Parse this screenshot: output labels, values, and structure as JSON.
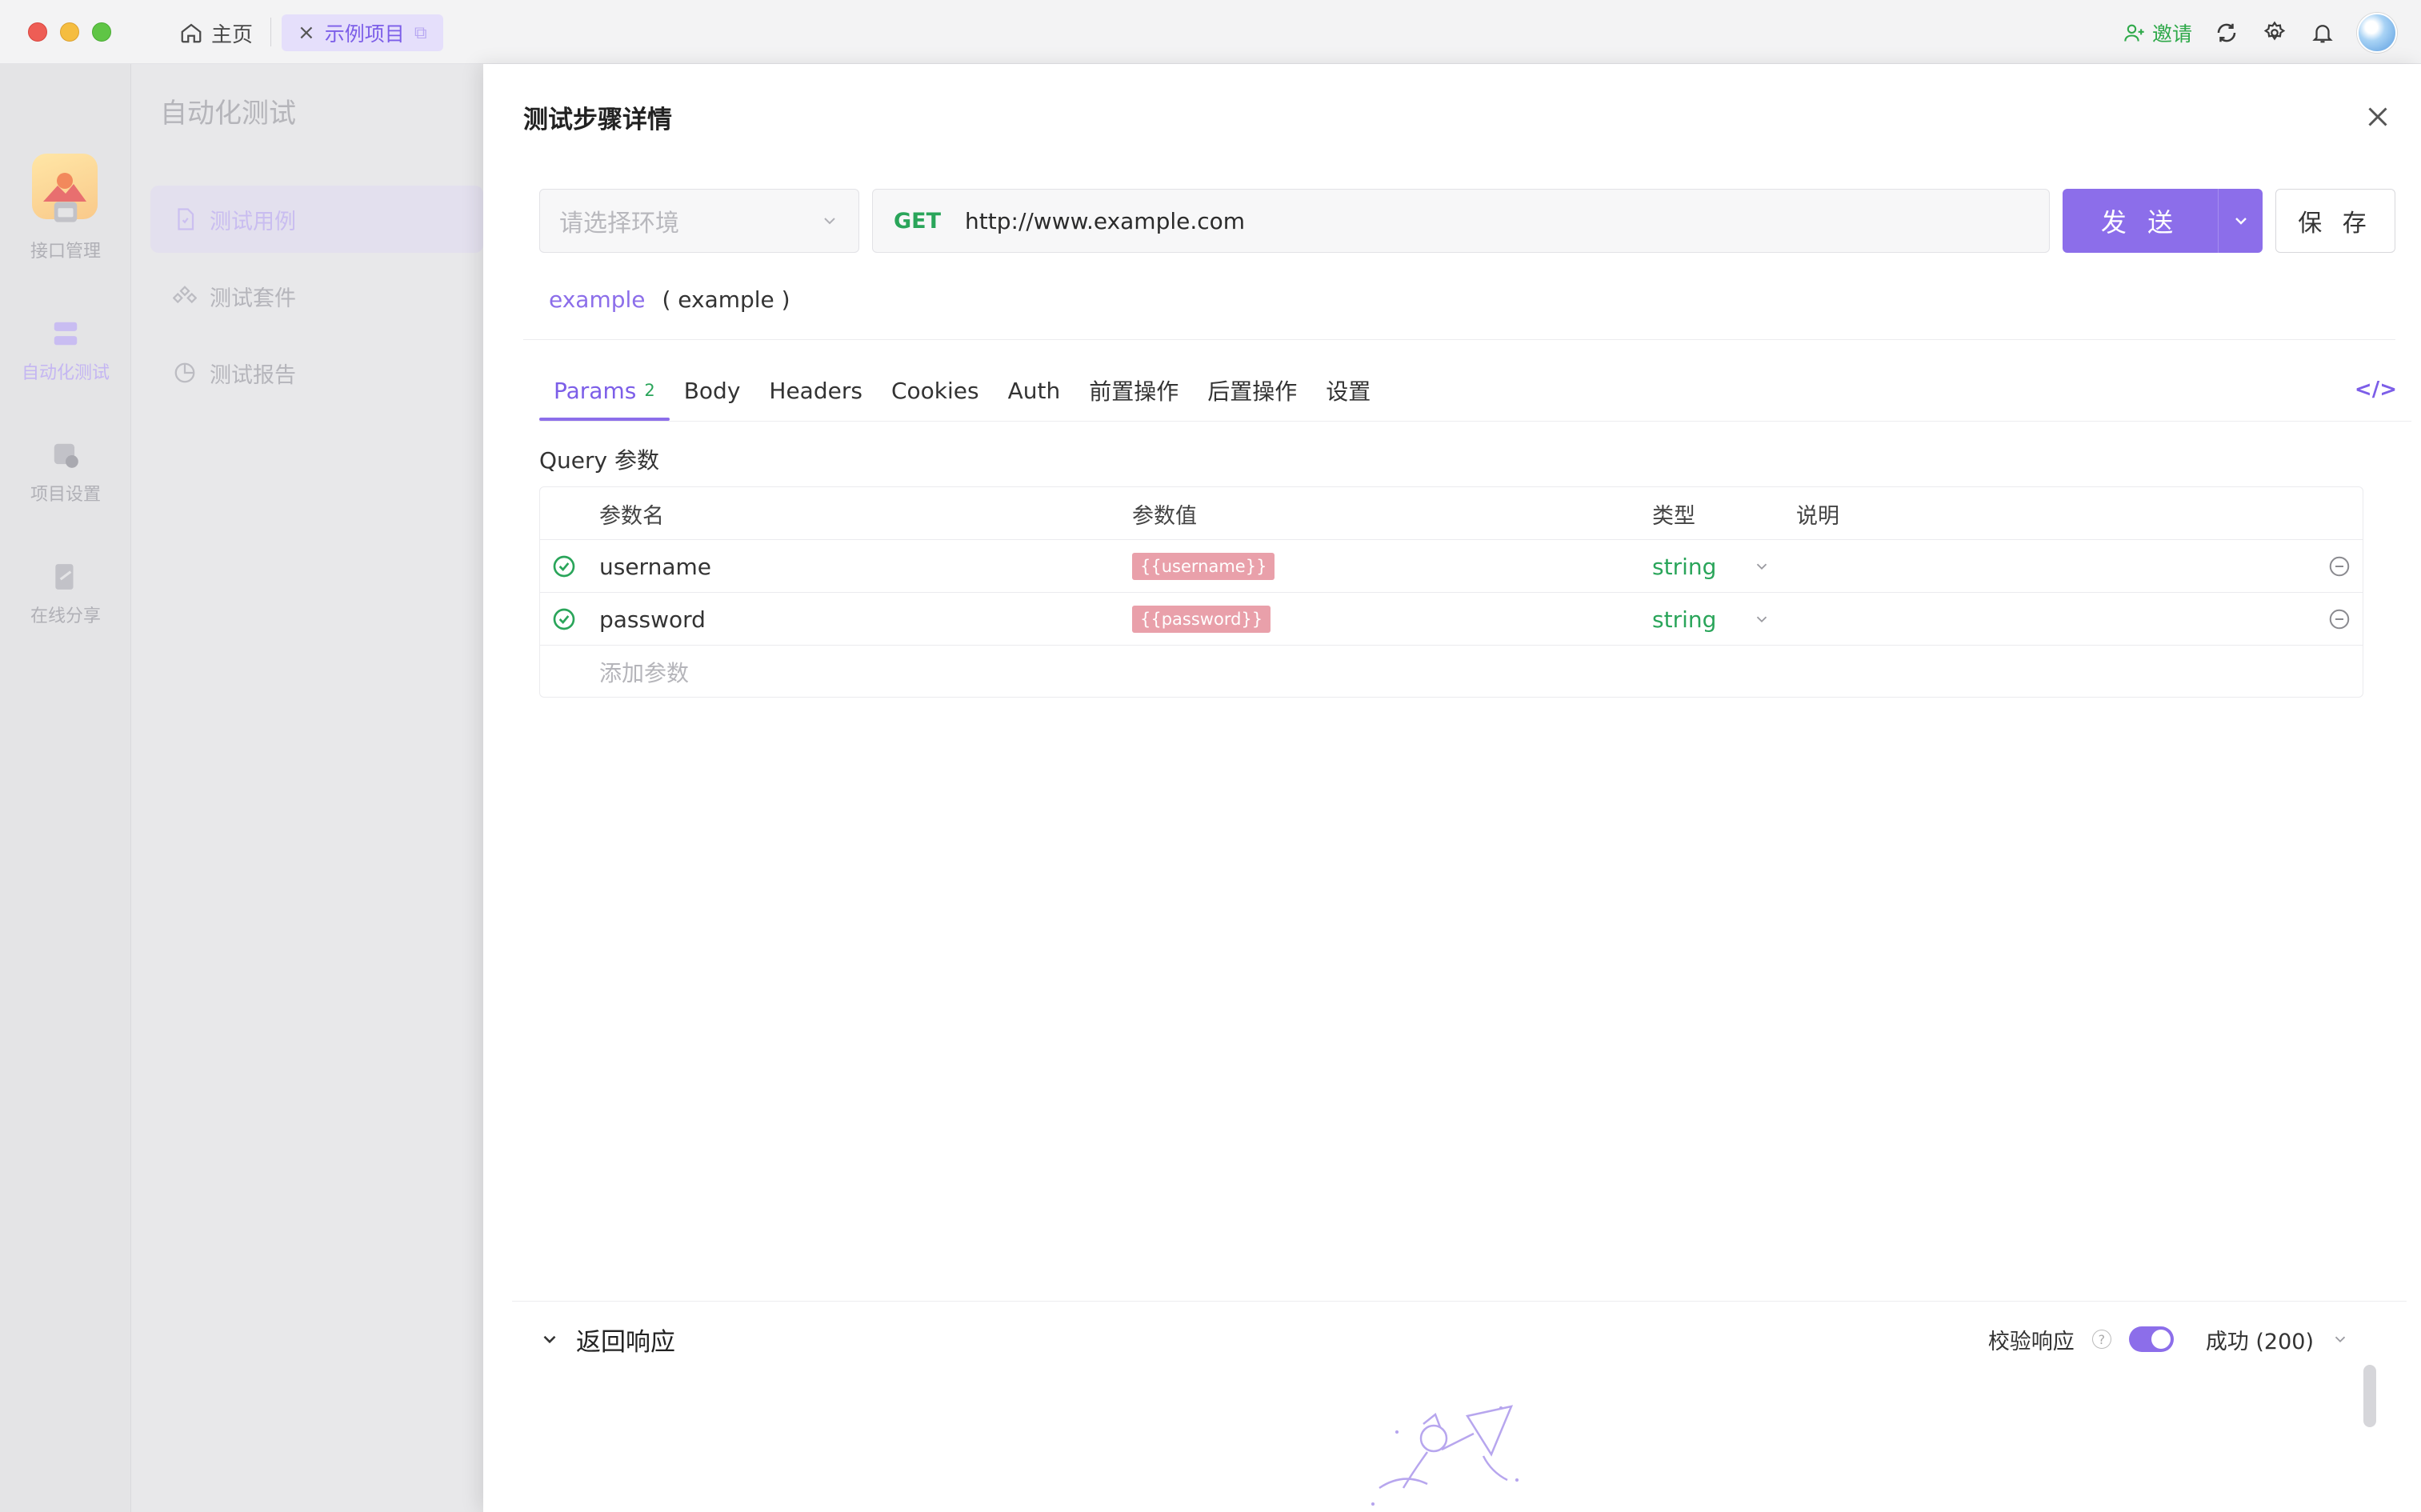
{
  "titlebar": {
    "home_tab": "主页",
    "project_tab": "示例项目",
    "invite_label": "邀请"
  },
  "rail": {
    "items": [
      {
        "label": "接口管理",
        "icon": "api-icon"
      },
      {
        "label": "自动化测试",
        "icon": "automation-icon"
      },
      {
        "label": "项目设置",
        "icon": "project-settings-icon"
      },
      {
        "label": "在线分享",
        "icon": "share-icon"
      }
    ]
  },
  "module": {
    "title": "自动化测试",
    "items": [
      {
        "label": "测试用例",
        "icon": "test-case-icon"
      },
      {
        "label": "测试套件",
        "icon": "test-suite-icon"
      },
      {
        "label": "测试报告",
        "icon": "test-report-icon"
      }
    ]
  },
  "drawer": {
    "title": "测试步骤详情",
    "env_placeholder": "请选择环境",
    "method": "GET",
    "url": "http://www.example.com",
    "send_label": "发 送",
    "save_label": "保 存",
    "step_link": "example",
    "step_name": "( example )",
    "tabs": [
      {
        "label": "Params",
        "count": "2"
      },
      {
        "label": "Body"
      },
      {
        "label": "Headers"
      },
      {
        "label": "Cookies"
      },
      {
        "label": "Auth"
      },
      {
        "label": "前置操作"
      },
      {
        "label": "后置操作"
      },
      {
        "label": "设置"
      }
    ],
    "query_title": "Query 参数",
    "params_table": {
      "headers": [
        "参数名",
        "参数值",
        "类型",
        "说明"
      ],
      "rows": [
        {
          "name": "username",
          "value": "{{username}}",
          "type": "string",
          "desc": ""
        },
        {
          "name": "password",
          "value": "{{password}}",
          "type": "string",
          "desc": ""
        }
      ],
      "add_placeholder": "添加参数"
    },
    "response": {
      "title": "返回响应",
      "validate_label": "校验响应",
      "status": "成功 (200)"
    }
  },
  "colors": {
    "accent": "#8c6eea",
    "success": "#2aa55a",
    "variable_tag": "#e9a0aa"
  }
}
